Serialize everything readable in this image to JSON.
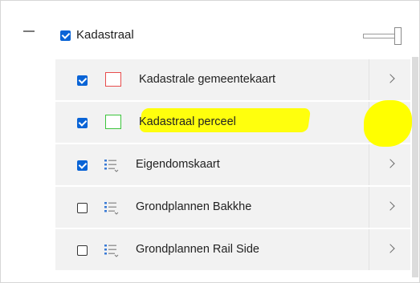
{
  "layer_group": {
    "title": "Kadastraal",
    "checked": true
  },
  "layers": [
    {
      "label": "Kadastrale gemeentekaart",
      "checked": true,
      "icon": "red-square-swatch-icon",
      "swatch_color": "#e84c4c"
    },
    {
      "label": "Kadastraal perceel",
      "checked": true,
      "icon": "green-square-swatch-icon",
      "swatch_color": "#3cc43c"
    },
    {
      "label": "Eigendomskaart",
      "checked": true,
      "icon": "list-legend-icon"
    },
    {
      "label": "Grondplannen Bakkhe",
      "checked": false,
      "icon": "list-legend-icon"
    },
    {
      "label": "Grondplannen Rail Side",
      "checked": false,
      "icon": "list-legend-icon"
    }
  ],
  "colors": {
    "checkbox_accent": "#0a64d6",
    "row_background": "#f2f2f2",
    "highlight": "#ffff00"
  }
}
